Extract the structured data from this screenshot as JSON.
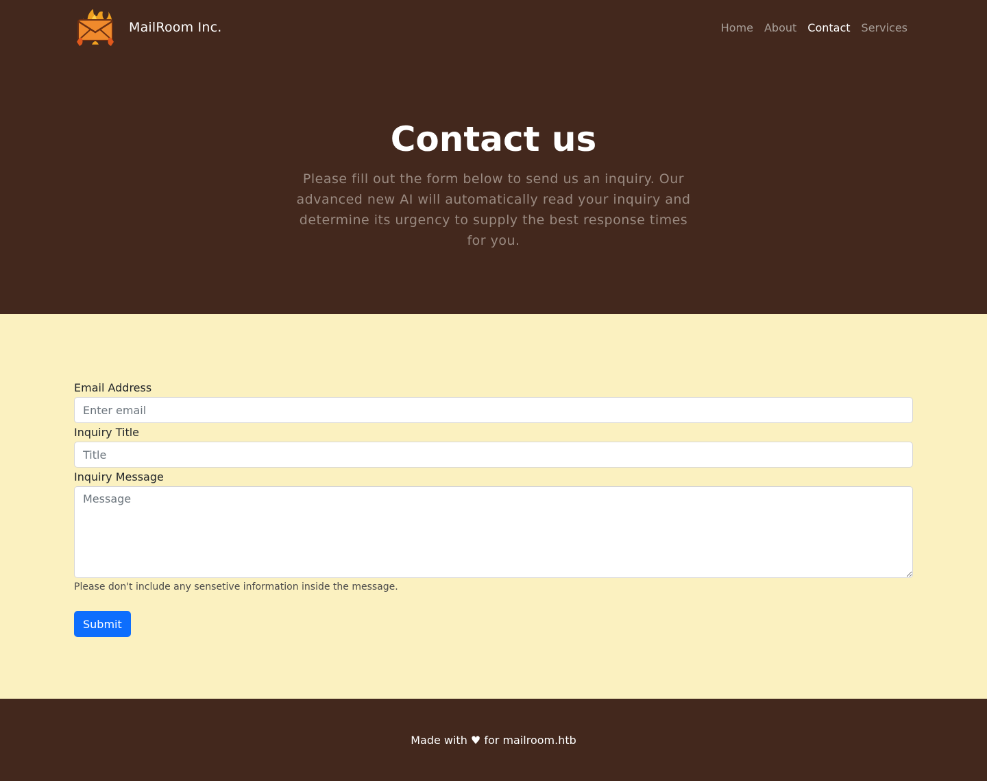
{
  "nav": {
    "brand_name": "MailRoom Inc.",
    "links": [
      {
        "label": "Home",
        "active": false
      },
      {
        "label": "About",
        "active": false
      },
      {
        "label": "Contact",
        "active": true
      },
      {
        "label": "Services",
        "active": false
      }
    ],
    "logo_icon": "burning-envelope-icon"
  },
  "hero": {
    "title": "Contact us",
    "lead": "Please fill out the form below to send us an inquiry. Our advanced new AI will automatically read your inquiry and determine its urgency to supply the best response times for you."
  },
  "form": {
    "email_label": "Email Address",
    "email_placeholder": "Enter email",
    "email_value": "",
    "title_label": "Inquiry Title",
    "title_placeholder": "Title",
    "title_value": "",
    "message_label": "Inquiry Message",
    "message_placeholder": "Message",
    "message_value": "",
    "help_text": "Please don't include any sensetive information inside the message.",
    "submit_label": "Submit"
  },
  "footer": {
    "text": "Made with ♥ for mailroom.htb"
  },
  "colors": {
    "header_bg": "#43281d",
    "page_bg": "#fbf1c0",
    "primary": "#0d6efd"
  }
}
